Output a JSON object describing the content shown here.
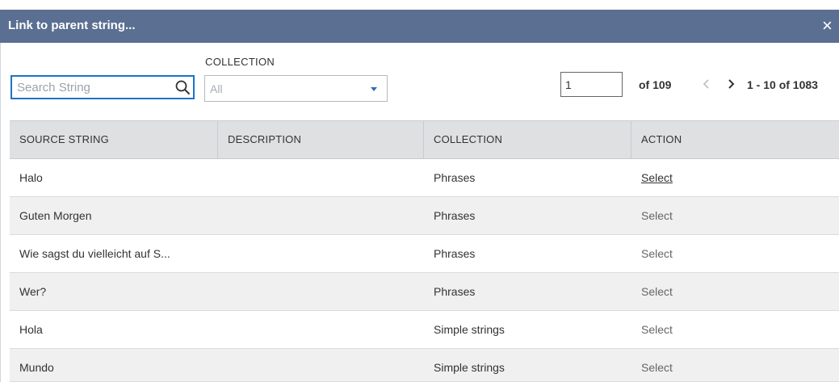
{
  "dialog": {
    "title": "Link to parent string...",
    "close_glyph": "×"
  },
  "search": {
    "placeholder": "Search String",
    "value": ""
  },
  "collection_filter": {
    "label": "COLLECTION",
    "selected": "All"
  },
  "pagination": {
    "current_page": "1",
    "of_pages": "of 109",
    "prev_glyph": "‹",
    "next_glyph": "›",
    "range": "1 - 10 of 1083"
  },
  "table": {
    "columns": [
      "SOURCE STRING",
      "DESCRIPTION",
      "COLLECTION",
      "ACTION"
    ],
    "rows": [
      {
        "source": "Halo",
        "description": "",
        "collection": "Phrases",
        "action": "Select"
      },
      {
        "source": "Guten Morgen",
        "description": "",
        "collection": "Phrases",
        "action": "Select"
      },
      {
        "source": "Wie sagst du vielleicht auf S...",
        "description": "",
        "collection": "Phrases",
        "action": "Select"
      },
      {
        "source": "Wer?",
        "description": "",
        "collection": "Phrases",
        "action": "Select"
      },
      {
        "source": "Hola",
        "description": "",
        "collection": "Simple strings",
        "action": "Select"
      },
      {
        "source": "Mundo",
        "description": "",
        "collection": "Simple strings",
        "action": "Select"
      }
    ]
  },
  "colors": {
    "title_bar": "#5b6f92",
    "focus": "#1e73c8",
    "caret": "#2d6db5",
    "header_bg": "#dfe0e2",
    "row_alt": "#f0f0f0"
  },
  "icons": {
    "search": "search-icon",
    "close": "close-icon",
    "dropdown": "caret-down-icon",
    "prev": "chevron-left-icon",
    "next": "chevron-right-icon"
  }
}
